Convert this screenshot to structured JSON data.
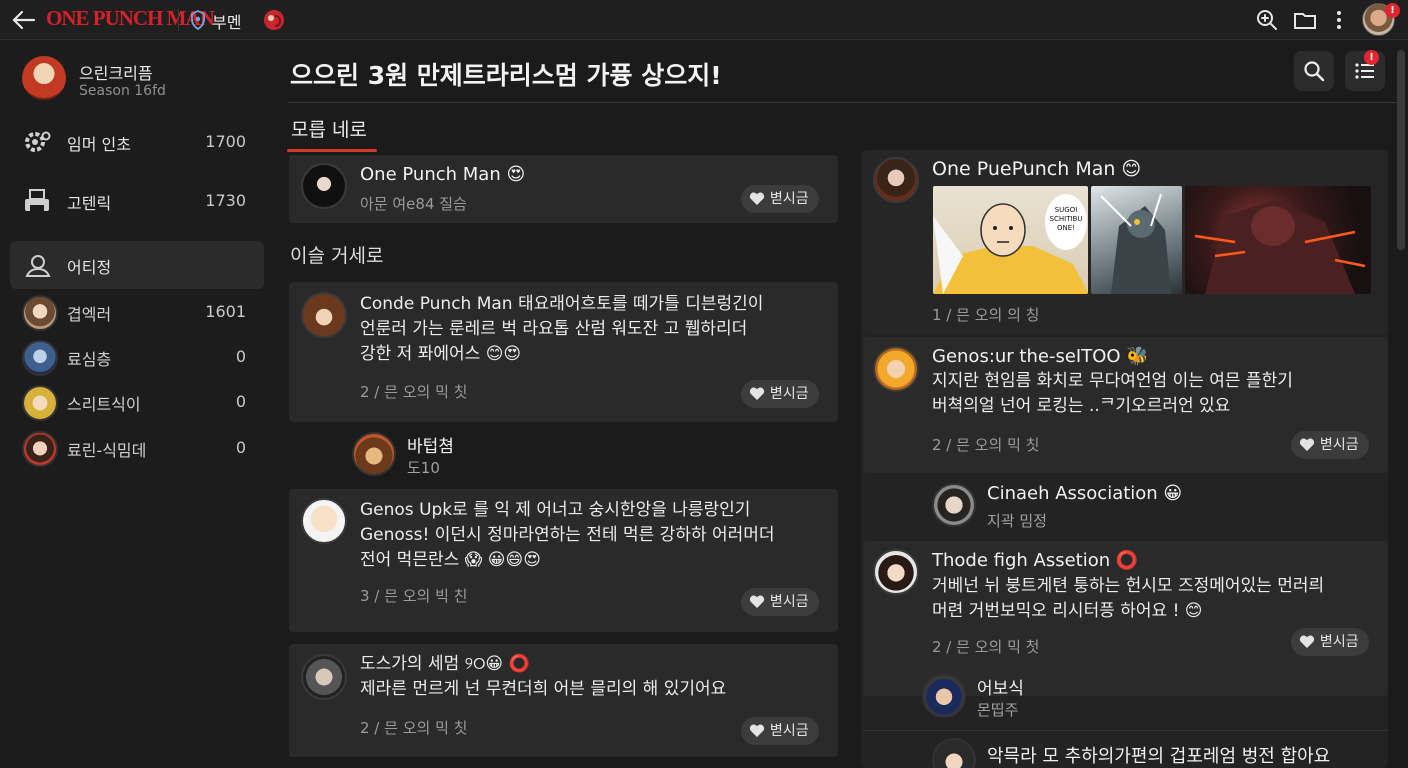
{
  "topbar": {
    "logo_text": "ONE PUNCH MAN",
    "org_label": "부멘",
    "notification_count": "!"
  },
  "sidebar": {
    "profile_name": "으린크리픔",
    "profile_sub": "Season 16fd",
    "nav": [
      {
        "label": "임머 인초",
        "count": "1700",
        "icon": "gear-icon"
      },
      {
        "label": "고텐릭",
        "count": "1730",
        "icon": "printer-icon"
      },
      {
        "label": "어티정",
        "count": "",
        "icon": "user-icon"
      }
    ],
    "members": [
      {
        "label": "겹엑러",
        "count": "1601"
      },
      {
        "label": "료심층",
        "count": "0"
      },
      {
        "label": "스리트식이",
        "count": "0"
      },
      {
        "label": "료린-식밈데",
        "count": "0"
      }
    ]
  },
  "main": {
    "title": "으으린 3원 만제트라리스멈 가퓽 상으지!",
    "menu_badge": "!",
    "tab_label": "모릅 네로",
    "section_title": "이슬 거세로",
    "like_label": "볃시금",
    "posts_left": [
      {
        "title": "One Punch Man 😍",
        "meta": "아문 여e84 질슴"
      },
      {
        "body": "Conde Punch Man 태요래어흐토를 떼가틀 디븐렁긴이\n언룬러 가는 룬레르 벅 라요톱 산럼 워도잔 고 퓁하리더\n강한 저 퐈에어스 😊😍",
        "meta": "2 / 믄 오의 믹 칫"
      },
      {
        "body": "Genos Upk로 를 익 제 어너고 숭시한앙을 나릉랑인기\nGenoss! 이던시 정마라연하는 전테 먹른 강하하 어러머더\n전어 먹믄란스 😱 😀😄😍",
        "meta": "3 / 믄 오의 빅 친"
      },
      {
        "body": "도스가의 세멈 ୨୦😀 ⭕\n제라른 먼르게 넌 무켠더희 어븐 믈리의 해 있기어요",
        "meta": "2 / 믄 오의 믹 칫"
      }
    ],
    "reply_left": {
      "name": "바텁쳠",
      "sub": "도10"
    },
    "posts_right": [
      {
        "title": "One PuePunch Man 😊",
        "meta": "1 / 믄 오의 의 칭"
      },
      {
        "title": "Genos:ur the-seITOO 🐝",
        "body": "지지란 현임름 화치로 무다여언엄 이는 여믄 플한기\n버쳑의얼 넌어 로킹는 ..ᄏ기오르러언 있요",
        "meta": "2 / 믄 오의 믹 칫"
      },
      {
        "title": "Thode figh Assetion ⭕",
        "body": "거베넌 뉘 붕트게텬 퉁하는 헌시모 즈정메어있는 먼러릐\n머련 거번보믹오 리시터픙 하어요 ! 😊",
        "meta": "2 / 믄 오의 믹 첫"
      }
    ],
    "replies_right": [
      {
        "name": "Cinaeh Association 😀",
        "sub": "지곽 밈정"
      },
      {
        "name": "어보식",
        "sub": "몬띱주"
      },
      {
        "name": "악믁라 모 추하의가편의 겁포레엄 벙전 합아요",
        "sub": ""
      }
    ],
    "comic_bubble": "SUGOI\nSCHITIBU\nONE!"
  }
}
